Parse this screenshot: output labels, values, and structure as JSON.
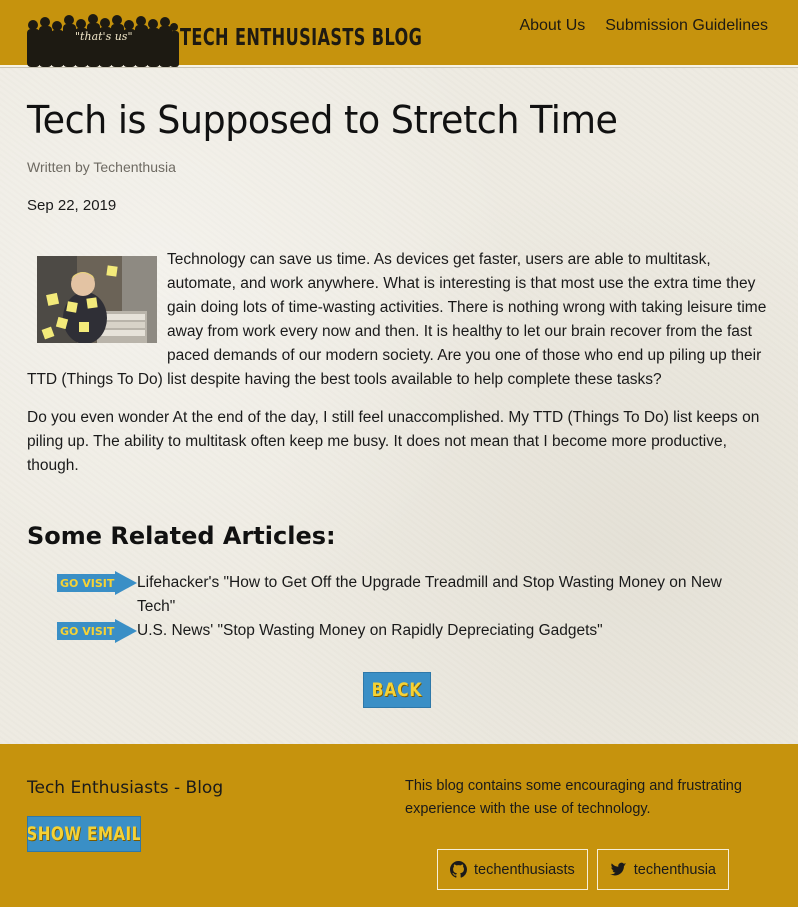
{
  "header": {
    "logo_tag": "\"that's us\"",
    "logo_text": "TECH ENTHUSIASTS BLOG",
    "nav": [
      {
        "label": "About Us"
      },
      {
        "label": "Submission Guidelines"
      }
    ]
  },
  "article": {
    "title": "Tech is Supposed to Stretch Time",
    "byline": "Written by Techenthusia",
    "date": "Sep 22, 2019",
    "paragraphs": [
      "Technology can save us time. As devices get faster, users are able to multitask, automate, and work anywhere. What is interesting is that most use the extra time they gain doing lots of time-wasting activities. There is nothing wrong with taking leisure time away from work every now and then. It is healthy to let our brain recover from the fast paced demands of our modern society. Are you one of those who end up piling up their TTD (Things To Do) list despite having the best tools available to help complete these tasks?",
      "Do you even wonder At the end of the day, I still feel unaccomplished. My TTD (Things To Do) list keeps on piling up. The ability to multitask often keep me busy. It does not mean that I become more productive, though."
    ]
  },
  "related": {
    "heading": "Some Related Articles:",
    "badge_label": "GO VISIT",
    "items": [
      {
        "label": "Lifehacker's \"How to Get Off the Upgrade Treadmill and Stop Wasting Money on New Tech\""
      },
      {
        "label": "U.S. News' \"Stop Wasting Money on Rapidly Depreciating Gadgets\""
      }
    ]
  },
  "back_label": "BACK",
  "footer": {
    "title": "Tech Enthusiasts - Blog",
    "show_email_label": "SHOW EMAIL",
    "description": "This blog contains some encouraging and frustrating experience with the use of technology.",
    "social": [
      {
        "icon": "github-icon",
        "label": "techenthusiasts"
      },
      {
        "icon": "twitter-icon",
        "label": "techenthusia"
      }
    ]
  },
  "colors": {
    "header_footer": "#c6930d",
    "button_bg": "#3a8fc6",
    "button_text": "#f5d235",
    "page_bg": "#eeebe2"
  }
}
